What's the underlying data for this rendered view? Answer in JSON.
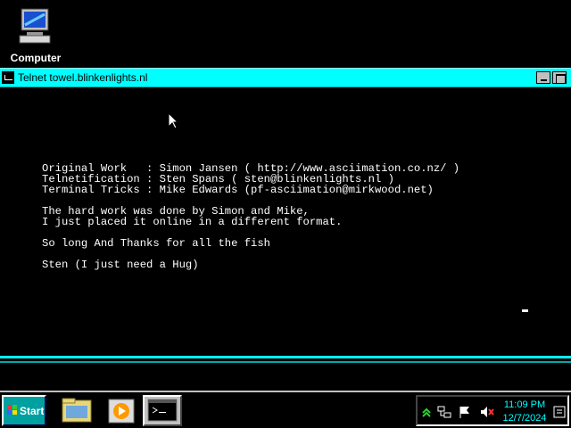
{
  "desktop": {
    "icon_label": "Computer"
  },
  "window": {
    "title": "Telnet towel.blinkenlights.nl"
  },
  "console": {
    "lines": [
      "Original Work   : Simon Jansen ( http://www.asciimation.co.nz/ )",
      "Telnetification : Sten Spans ( sten@blinkenlights.nl )",
      "Terminal Tricks : Mike Edwards (pf-asciimation@mirkwood.net)",
      "The hard work was done by Simon and Mike,",
      "I just placed it online in a different format.",
      "So long And Thanks for all the fish",
      "Sten (I just need a Hug)"
    ]
  },
  "taskbar": {
    "start_label": "Start",
    "clock_time": "11:09 PM",
    "clock_date": "12/7/2024"
  },
  "colors": {
    "titlebar": "#00ffff",
    "clock": "#00ffff",
    "start": "#00a0a0"
  }
}
